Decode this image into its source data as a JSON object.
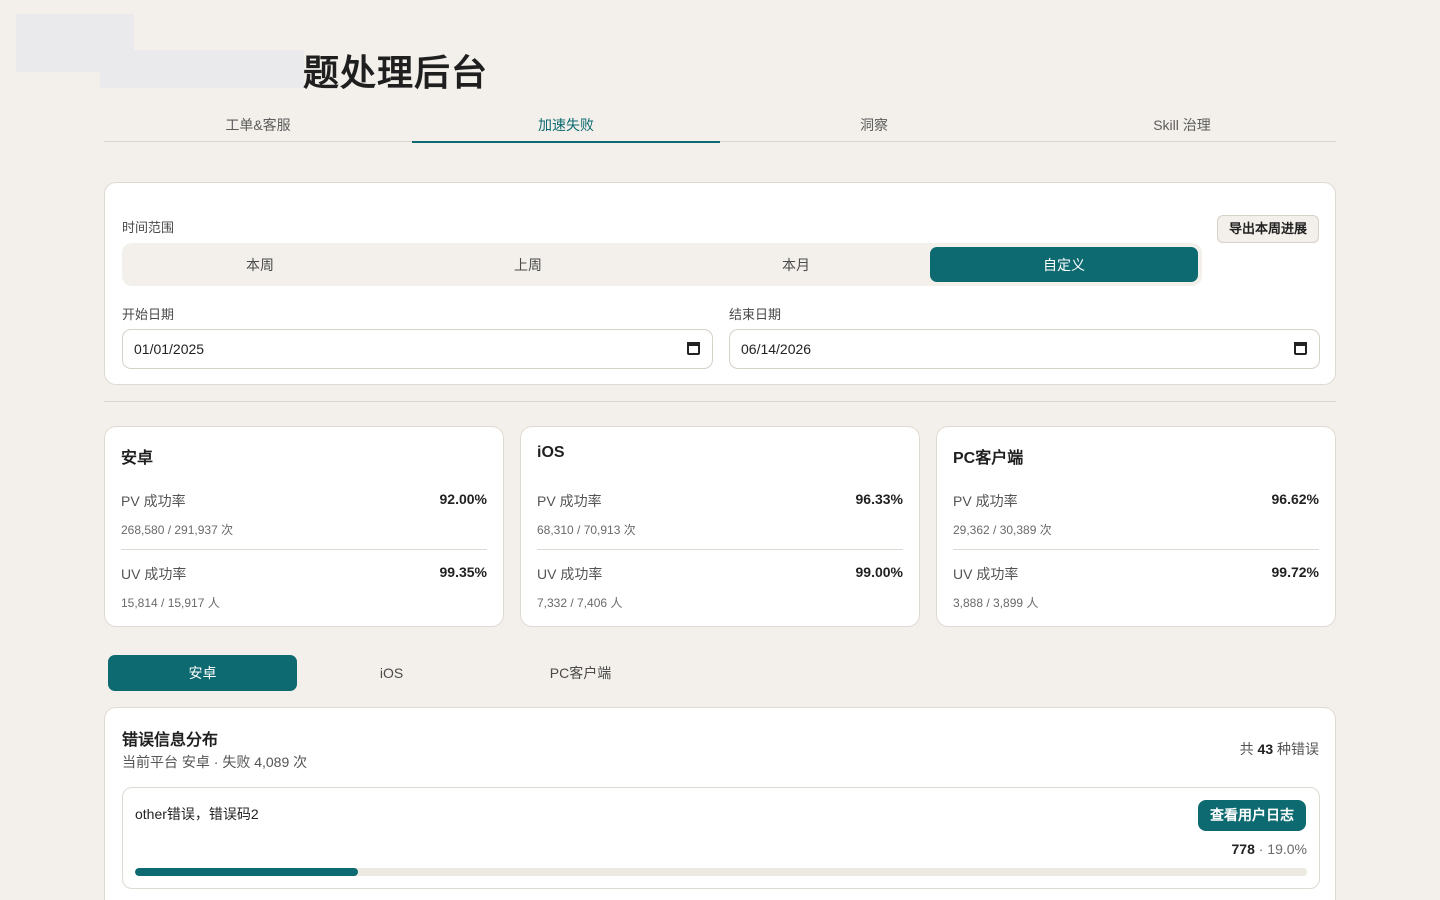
{
  "header": {
    "title": "题处理后台"
  },
  "main_tabs": [
    {
      "label": "工单&客服"
    },
    {
      "label": "加速失败"
    },
    {
      "label": "洞察"
    },
    {
      "label": "Skill 治理"
    }
  ],
  "filter": {
    "range_label": "时间范围",
    "export_label": "导出本周进展",
    "ranges": [
      "本周",
      "上周",
      "本月",
      "自定义"
    ],
    "start_label": "开始日期",
    "start_value": "01/01/2025",
    "end_label": "结束日期",
    "end_value": "06/14/2026"
  },
  "stats": [
    {
      "name": "安卓",
      "pv_label": "PV 成功率",
      "pv_rate": "92.00%",
      "pv_detail": "268,580 / 291,937 次",
      "uv_label": "UV 成功率",
      "uv_rate": "99.35%",
      "uv_detail": "15,814 / 15,917 人"
    },
    {
      "name": "iOS",
      "pv_label": "PV 成功率",
      "pv_rate": "96.33%",
      "pv_detail": "68,310 / 70,913 次",
      "uv_label": "UV 成功率",
      "uv_rate": "99.00%",
      "uv_detail": "7,332 / 7,406 人"
    },
    {
      "name": "PC客户端",
      "pv_label": "PV 成功率",
      "pv_rate": "96.62%",
      "pv_detail": "29,362 / 30,389 次",
      "uv_label": "UV 成功率",
      "uv_rate": "99.72%",
      "uv_detail": "3,888 / 3,899 人"
    }
  ],
  "platform_tabs": [
    "安卓",
    "iOS",
    "PC客户端"
  ],
  "errors": {
    "title": "错误信息分布",
    "subtitle": "当前平台 安卓 · 失败 4,089 次",
    "total_prefix": "共",
    "total_count": "43",
    "total_suffix": "种错误",
    "items": [
      {
        "message": "other错误，错误码2",
        "button": "查看用户日志",
        "count": "778",
        "percent_text": "· 19.0%",
        "share": 0.19
      }
    ]
  },
  "colors": {
    "accent": "#0d6a71",
    "background": "#f3f0eb"
  }
}
